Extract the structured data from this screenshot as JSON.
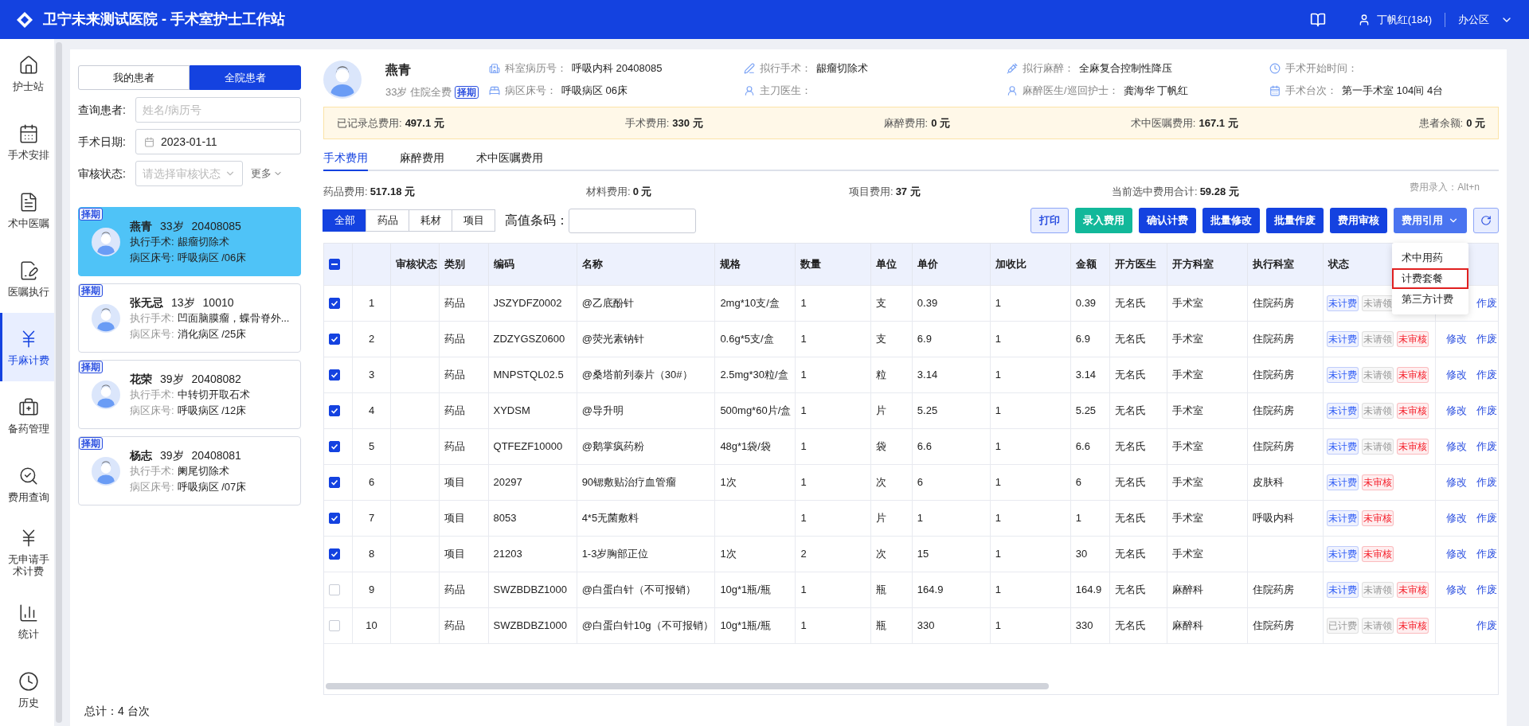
{
  "app": {
    "title": "卫宁未来测试医院 - 手术室护士工作站",
    "user": "丁帆红(184)",
    "workspace": "办公区"
  },
  "nav": [
    {
      "label": "护士站",
      "selected": false
    },
    {
      "label": "手术安排",
      "selected": false
    },
    {
      "label": "术中医嘱",
      "selected": false
    },
    {
      "label": "医嘱执行",
      "selected": false
    },
    {
      "label": "手麻计费",
      "selected": true
    },
    {
      "label": "备药管理",
      "selected": false
    },
    {
      "label": "费用查询",
      "selected": false
    },
    {
      "label": "无申请手术计费",
      "selected": false
    },
    {
      "label": "统计",
      "selected": false
    },
    {
      "label": "历史",
      "selected": false
    }
  ],
  "patient_scope": [
    {
      "label": "我的患者",
      "selected": false
    },
    {
      "label": "全院患者",
      "selected": true
    }
  ],
  "filters": {
    "query_label": "查询患者:",
    "query_placeholder": "姓名/病历号",
    "date_label": "手术日期:",
    "date_value": "2023-01-11",
    "audit_label": "审核状态:",
    "audit_placeholder": "请选择审核状态",
    "more": "更多"
  },
  "patients": [
    {
      "tag": "择期",
      "name": "燕青",
      "age": "33岁",
      "id": "20408085",
      "surgery_label": "执行手术:",
      "surgery": "龈瘤切除术",
      "ward_label": "病区床号:",
      "ward": "呼吸病区 /06床",
      "selected": true
    },
    {
      "tag": "择期",
      "name": "张无忌",
      "age": "13岁",
      "id": "10010",
      "surgery_label": "执行手术:",
      "surgery": "凹面脑膜瘤，蝶骨脊外...",
      "ward_label": "病区床号:",
      "ward": "消化病区 /25床",
      "selected": false
    },
    {
      "tag": "择期",
      "name": "花荣",
      "age": "39岁",
      "id": "20408082",
      "surgery_label": "执行手术:",
      "surgery": "中转切开取石术",
      "ward_label": "病区床号:",
      "ward": "呼吸病区 /12床",
      "selected": false
    },
    {
      "tag": "择期",
      "name": "杨志",
      "age": "39岁",
      "id": "20408081",
      "surgery_label": "执行手术:",
      "surgery": "阑尾切除术",
      "ward_label": "病区床号:",
      "ward": "呼吸病区 /07床",
      "selected": false
    }
  ],
  "total": "总计：4 台次",
  "current_patient": {
    "name": "燕青",
    "meta": "33岁 住院全费",
    "tag": "择期",
    "info": [
      {
        "label": "科室病历号：",
        "value": "呼吸内科 20408085"
      },
      {
        "label": "拟行手术：",
        "value": "龈瘤切除术"
      },
      {
        "label": "拟行麻醉：",
        "value": "全麻复合控制性降压"
      },
      {
        "label": "手术开始时间："
      },
      {
        "label": "病区床号：",
        "value": "呼吸病区 06床"
      },
      {
        "label": "主刀医生："
      },
      {
        "label": "麻醉医生/巡回护士：",
        "value": "龚海华 丁帆红"
      },
      {
        "label": "手术台次：",
        "value": "第一手术室 104间 4台"
      }
    ]
  },
  "fee_bar": [
    {
      "label": "已记录总费用:",
      "value": "497.1 元"
    },
    {
      "label": "手术费用:",
      "value": "330 元"
    },
    {
      "label": "麻醉费用:",
      "value": "0 元"
    },
    {
      "label": "术中医嘱费用:",
      "value": "167.1 元"
    },
    {
      "label": "患者余额:",
      "value": "0 元"
    }
  ],
  "tabs": [
    {
      "label": "手术费用",
      "selected": true
    },
    {
      "label": "麻醉费用",
      "selected": false
    },
    {
      "label": "术中医嘱费用",
      "selected": false
    }
  ],
  "summary": [
    {
      "label": "药品费用:",
      "value": "517.18 元"
    },
    {
      "label": "材料费用:",
      "value": "0 元"
    },
    {
      "label": "项目费用:",
      "value": "37 元"
    },
    {
      "label": "当前选中费用合计:",
      "value": "59.28 元"
    }
  ],
  "hotkey_hint": "费用录入：Alt+n",
  "category_filter": [
    {
      "label": "全部",
      "selected": true
    },
    {
      "label": "药品",
      "selected": false
    },
    {
      "label": "耗材",
      "selected": false
    },
    {
      "label": "项目",
      "selected": false
    }
  ],
  "barcode_label": "高值条码：",
  "buttons": [
    {
      "label": "打印",
      "kind": "outline"
    },
    {
      "label": "录入费用",
      "kind": "success"
    },
    {
      "label": "确认计费",
      "kind": "primary"
    },
    {
      "label": "批量修改",
      "kind": "primary"
    },
    {
      "label": "批量作废",
      "kind": "primary"
    },
    {
      "label": "费用审核",
      "kind": "primary"
    },
    {
      "label": "费用引用",
      "kind": "dropdown"
    },
    {
      "kind": "refresh"
    }
  ],
  "dropdown_menu": [
    {
      "label": "术中用药",
      "selected": false
    },
    {
      "label": "计费套餐",
      "selected": true
    },
    {
      "label": "第三方计费",
      "selected": false
    }
  ],
  "table": {
    "header_checkbox": {
      "indeterminate": true
    },
    "columns": [
      "审核状态",
      "类别",
      "编码",
      "名称",
      "规格",
      "数量",
      "单位",
      "单价",
      "加收比",
      "金额",
      "开方医生",
      "开方科室",
      "执行科室",
      "状态"
    ],
    "rows": [
      {
        "checked": true,
        "index": "1",
        "type": "药品",
        "code": "JSZYDFZ0002",
        "name": "@乙底酚针",
        "spec": "2mg*10支/盒",
        "qty": "1",
        "unit": "支",
        "price": "0.39",
        "ratio": "1",
        "amount": "0.39",
        "doctor": "无名氏",
        "dept": "手术室",
        "exec_dept": "住院药房",
        "tags": [
          {
            "label": "未计费",
            "color": "#2f5cf5"
          },
          {
            "label": "未请领",
            "color": "#999999"
          }
        ],
        "actions": [
          {
            "label": "作废"
          }
        ]
      },
      {
        "checked": true,
        "index": "2",
        "type": "药品",
        "code": "ZDZYGSZ0600",
        "name": "@荧光素钠针",
        "spec": "0.6g*5支/盒",
        "qty": "1",
        "unit": "支",
        "price": "6.9",
        "ratio": "1",
        "amount": "6.9",
        "doctor": "无名氏",
        "dept": "手术室",
        "exec_dept": "住院药房",
        "tags": [
          {
            "label": "未计费",
            "color": "#2f5cf5"
          },
          {
            "label": "未请领",
            "color": "#999999"
          },
          {
            "label": "未审核",
            "color": "#f5222d"
          }
        ],
        "actions": [
          {
            "label": "修改"
          },
          {
            "label": "作废"
          }
        ]
      },
      {
        "checked": true,
        "index": "3",
        "type": "药品",
        "code": "MNPSTQL02.5",
        "name": "@桑塔前列泰片（30#）",
        "spec": "2.5mg*30粒/盒",
        "qty": "1",
        "unit": "粒",
        "price": "3.14",
        "ratio": "1",
        "amount": "3.14",
        "doctor": "无名氏",
        "dept": "手术室",
        "exec_dept": "住院药房",
        "tags": [
          {
            "label": "未计费",
            "color": "#2f5cf5"
          },
          {
            "label": "未请领",
            "color": "#999999"
          },
          {
            "label": "未审核",
            "color": "#f5222d"
          }
        ],
        "actions": [
          {
            "label": "修改"
          },
          {
            "label": "作废"
          }
        ]
      },
      {
        "checked": true,
        "index": "4",
        "type": "药品",
        "code": "XYDSM",
        "name": "@导升明",
        "spec": "500mg*60片/盒",
        "qty": "1",
        "unit": "片",
        "price": "5.25",
        "ratio": "1",
        "amount": "5.25",
        "doctor": "无名氏",
        "dept": "手术室",
        "exec_dept": "住院药房",
        "tags": [
          {
            "label": "未计费",
            "color": "#2f5cf5"
          },
          {
            "label": "未请领",
            "color": "#999999"
          },
          {
            "label": "未审核",
            "color": "#f5222d"
          }
        ],
        "actions": [
          {
            "label": "修改"
          },
          {
            "label": "作废"
          }
        ]
      },
      {
        "checked": true,
        "index": "5",
        "type": "药品",
        "code": "QTFEZF10000",
        "name": "@鹅掌疯药粉",
        "spec": "48g*1袋/袋",
        "qty": "1",
        "unit": "袋",
        "price": "6.6",
        "ratio": "1",
        "amount": "6.6",
        "doctor": "无名氏",
        "dept": "手术室",
        "exec_dept": "住院药房",
        "tags": [
          {
            "label": "未计费",
            "color": "#2f5cf5"
          },
          {
            "label": "未请领",
            "color": "#999999"
          },
          {
            "label": "未审核",
            "color": "#f5222d"
          }
        ],
        "actions": [
          {
            "label": "修改"
          },
          {
            "label": "作废"
          }
        ]
      },
      {
        "checked": true,
        "index": "6",
        "type": "项目",
        "code": "20297",
        "name": "90锶敷贴治疗血管瘤",
        "spec": "1次",
        "qty": "1",
        "unit": "次",
        "price": "6",
        "ratio": "1",
        "amount": "6",
        "doctor": "无名氏",
        "dept": "手术室",
        "exec_dept": "皮肤科",
        "tags": [
          {
            "label": "未计费",
            "color": "#2f5cf5"
          },
          {
            "label": "未审核",
            "color": "#f5222d"
          }
        ],
        "actions": [
          {
            "label": "修改"
          },
          {
            "label": "作废"
          }
        ]
      },
      {
        "checked": true,
        "index": "7",
        "type": "项目",
        "code": "8053",
        "name": "4*5无菌敷料",
        "qty": "1",
        "unit": "片",
        "price": "1",
        "ratio": "1",
        "amount": "1",
        "doctor": "无名氏",
        "dept": "手术室",
        "exec_dept": "呼吸内科",
        "tags": [
          {
            "label": "未计费",
            "color": "#2f5cf5"
          },
          {
            "label": "未审核",
            "color": "#f5222d"
          }
        ],
        "actions": [
          {
            "label": "修改"
          },
          {
            "label": "作废"
          }
        ]
      },
      {
        "checked": true,
        "index": "8",
        "type": "项目",
        "code": "21203",
        "name": "1-3岁胸部正位",
        "spec": "1次",
        "qty": "2",
        "unit": "次",
        "price": "15",
        "ratio": "1",
        "amount": "30",
        "doctor": "无名氏",
        "dept": "手术室",
        "tags": [
          {
            "label": "未计费",
            "color": "#2f5cf5"
          },
          {
            "label": "未审核",
            "color": "#f5222d"
          }
        ],
        "actions": [
          {
            "label": "修改"
          },
          {
            "label": "作废"
          }
        ]
      },
      {
        "checked": false,
        "index": "9",
        "type": "药品",
        "code": "SWZBDBZ1000",
        "name": "@白蛋白针（不可报销）",
        "spec": "10g*1瓶/瓶",
        "qty": "1",
        "unit": "瓶",
        "price": "164.9",
        "ratio": "1",
        "amount": "164.9",
        "doctor": "无名氏",
        "dept": "麻醉科",
        "exec_dept": "住院药房",
        "tags": [
          {
            "label": "未计费",
            "color": "#2f5cf5"
          },
          {
            "label": "未请领",
            "color": "#999999"
          },
          {
            "label": "未审核",
            "color": "#f5222d"
          }
        ],
        "actions": [
          {
            "label": "修改"
          },
          {
            "label": "作废"
          }
        ]
      },
      {
        "checked": false,
        "index": "10",
        "type": "药品",
        "code": "SWZBDBZ1000",
        "name": "@白蛋白针10g（不可报销）",
        "spec": "10g*1瓶/瓶",
        "qty": "1",
        "unit": "瓶",
        "price": "330",
        "ratio": "1",
        "amount": "330",
        "doctor": "无名氏",
        "dept": "麻醉科",
        "exec_dept": "住院药房",
        "tags": [
          {
            "label": "已计费",
            "color": "#999999"
          },
          {
            "label": "未请领",
            "color": "#999999"
          },
          {
            "label": "未审核",
            "color": "#f5222d"
          }
        ],
        "actions": [
          {
            "label": "作废"
          }
        ]
      }
    ]
  }
}
